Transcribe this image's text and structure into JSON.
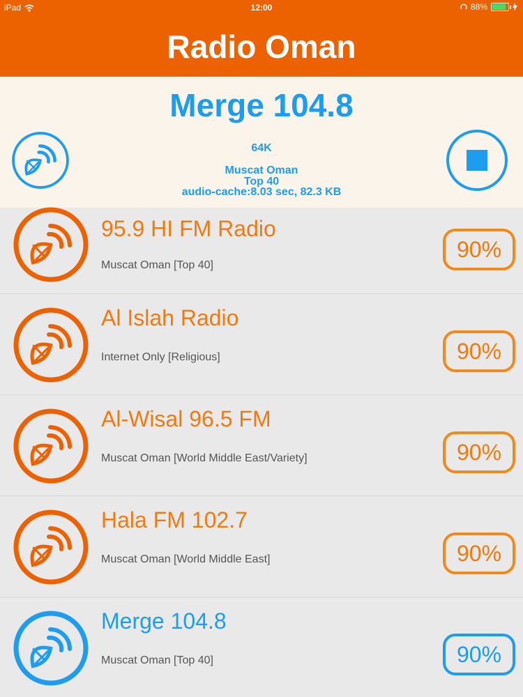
{
  "status_bar": {
    "device": "iPad",
    "time": "12:00",
    "battery": "88%",
    "battery_level": 0.88
  },
  "nav": {
    "title": "Radio Oman"
  },
  "now_playing": {
    "title": "Merge 104.8",
    "bitrate": "64K",
    "location": "Muscat Oman",
    "genre": "Top 40",
    "cache": "audio-cache:8.03 sec, 82.3 KB"
  },
  "stations": [
    {
      "name": "95.9 HI FM Radio",
      "desc": "Muscat Oman [Top 40]",
      "quality": "90%"
    },
    {
      "name": "Al Islah Radio",
      "desc": "Internet Only [Religious]",
      "quality": "90%"
    },
    {
      "name": "Al-Wisal 96.5 FM",
      "desc": "Muscat Oman [World Middle East/Variety]",
      "quality": "90%"
    },
    {
      "name": "Hala FM 102.7",
      "desc": "Muscat Oman [World Middle East]",
      "quality": "90%"
    },
    {
      "name": "Merge 104.8",
      "desc": "Muscat Oman [Top 40]",
      "quality": "90%"
    }
  ],
  "colors": {
    "accent_orange": "#ec6200",
    "accent_blue": "#1e9cf0",
    "header_bg": "#faf4ea"
  },
  "icons": {
    "station": "radio-signal-icon",
    "stop": "stop-icon",
    "wifi": "wifi-icon",
    "battery": "battery-icon",
    "charging": "charging-icon"
  }
}
